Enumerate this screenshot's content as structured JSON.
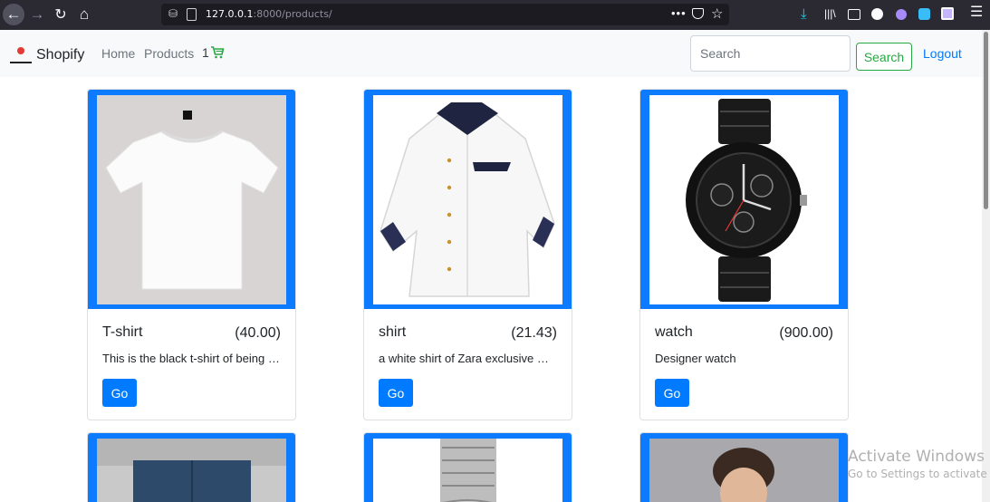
{
  "browser": {
    "url_host": "127.0.0.1",
    "url_rest": ":8000/products/",
    "icons": [
      "back-arrow-icon",
      "forward-arrow-icon",
      "reload-icon",
      "home-icon",
      "shield-icon",
      "page-icon",
      "more-dots-icon",
      "pocket-icon",
      "star-icon",
      "download-icon",
      "library-icon",
      "sidebar-icon",
      "account-icon",
      "extension-icon",
      "menu-icon"
    ]
  },
  "navbar": {
    "brand": "Shopify",
    "links": [
      "Home",
      "Products"
    ],
    "cart_count": "1",
    "search_placeholder": "Search",
    "search_button": "Search",
    "logout": "Logout"
  },
  "products": [
    {
      "title": "T-shirt",
      "price": "(40.00)",
      "description": "This is the black t-shirt of being human",
      "button": "Go"
    },
    {
      "title": "shirt",
      "price": "(21.43)",
      "description": "a white shirt of Zara exclusive material",
      "button": "Go"
    },
    {
      "title": "watch",
      "price": "(900.00)",
      "description": "Designer watch",
      "button": "Go"
    }
  ],
  "watermark": {
    "line1": "Activate Windows",
    "line2": "Go to Settings to activate Windows."
  },
  "colors": {
    "accent": "#007bff",
    "card_frame": "#0d7bff",
    "success": "#28a745",
    "chrome": "#2b2a33"
  }
}
